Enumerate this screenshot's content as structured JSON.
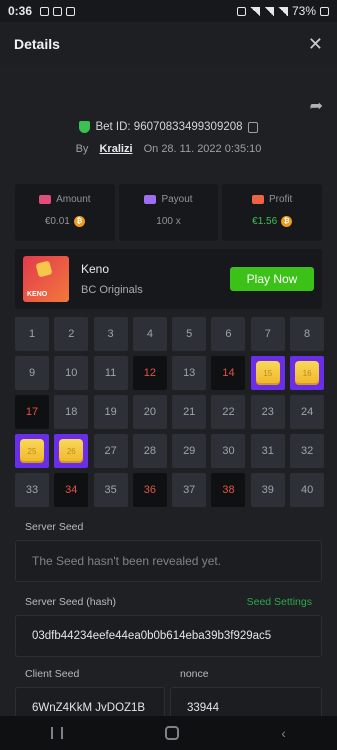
{
  "status": {
    "time": "0:36",
    "battery": "73%"
  },
  "header": {
    "title": "Details",
    "close_glyph": "✕"
  },
  "bet": {
    "id_text": "Bet ID: 96070833499309208",
    "by_label": "By",
    "user": "Kralizi",
    "on_label": "On",
    "date": "28. 11. 2022 0:35:10"
  },
  "stats": {
    "amount_label": "Amount",
    "amount_value": "€0.01",
    "payout_label": "Payout",
    "payout_value": "100 x",
    "profit_label": "Profit",
    "profit_value": "€1.56",
    "coin_glyph": "₿"
  },
  "game": {
    "name": "Keno",
    "provider": "BC Originals",
    "play_label": "Play Now",
    "thumb_text": "KENO"
  },
  "grid": {
    "numbers": [
      "1",
      "2",
      "3",
      "4",
      "5",
      "6",
      "7",
      "8",
      "9",
      "10",
      "11",
      "12",
      "13",
      "14",
      "15",
      "16",
      "17",
      "18",
      "19",
      "20",
      "21",
      "22",
      "23",
      "24",
      "25",
      "26",
      "27",
      "28",
      "29",
      "30",
      "31",
      "32",
      "33",
      "34",
      "35",
      "36",
      "37",
      "38",
      "39",
      "40"
    ],
    "drawn": [
      "12",
      "14",
      "17",
      "34",
      "36",
      "38"
    ],
    "hits": [
      "15",
      "16",
      "25",
      "26"
    ]
  },
  "seeds": {
    "server_seed_label": "Server Seed",
    "server_seed_value": "The Seed hasn't been revealed yet.",
    "server_hash_label": "Server Seed (hash)",
    "seed_settings_label": "Seed Settings",
    "server_hash_value": "03dfb44234eefe44ea0b0b614eba39b3f929ac5",
    "client_seed_label": "Client Seed",
    "nonce_label": "nonce",
    "client_seed_value": "6WnZ4KkM JvDOZ1B",
    "nonce_value": "33944"
  },
  "colors": {
    "accent_green": "#3bc117",
    "hit_purple": "#6a2ee8",
    "drawn_red": "#e5524a"
  }
}
